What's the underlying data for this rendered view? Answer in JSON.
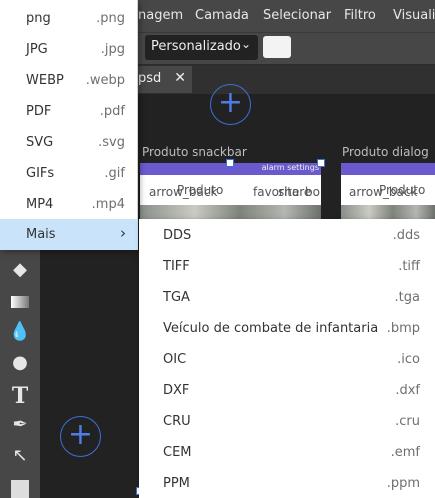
{
  "menubar": {
    "items": [
      "nagem",
      "Camada",
      "Selecionar",
      "Filtro",
      "Visualiz"
    ]
  },
  "options_bar": {
    "colon": ":",
    "preset_value": "Personalizado",
    "swatch_color": "#f3f3f3"
  },
  "document_tab": {
    "label": "psd",
    "close": "✕"
  },
  "artboards": [
    {
      "label": "Produto snackbar",
      "texts": [
        "arrow_back",
        "Produto",
        "favorite",
        "share",
        "bo"
      ],
      "bar_text": "alarm settings"
    },
    {
      "label": "Produto dialog",
      "texts": [
        "arrow_back",
        "Produto"
      ]
    }
  ],
  "export_menu": {
    "items": [
      {
        "label": "png",
        "ext": ".png"
      },
      {
        "label": "JPG",
        "ext": ".jpg"
      },
      {
        "label": "WEBP",
        "ext": ".webp"
      },
      {
        "label": "PDF",
        "ext": ".pdf"
      },
      {
        "label": "SVG",
        "ext": ".svg"
      },
      {
        "label": "GIFs",
        "ext": ".gif"
      },
      {
        "label": "MP4",
        "ext": ".mp4"
      },
      {
        "label": "Mais",
        "ext": "›"
      }
    ]
  },
  "sub_menu": {
    "items": [
      {
        "label": "DDS",
        "ext": ".dds"
      },
      {
        "label": "TIFF",
        "ext": ".tiff"
      },
      {
        "label": "TGA",
        "ext": ".tga"
      },
      {
        "label": "Veículo de combate de infantaria",
        "ext": ".bmp"
      },
      {
        "label": "OIC",
        "ext": ".ico"
      },
      {
        "label": "DXF",
        "ext": ".dxf"
      },
      {
        "label": "CRU",
        "ext": ".cru"
      },
      {
        "label": "CEM",
        "ext": ".emf"
      },
      {
        "label": "PPM",
        "ext": ".ppm"
      }
    ]
  },
  "colors": {
    "menu_highlight": "#c9e4fa",
    "accent_blue": "#3d6fd8",
    "artboard_bar": "#6a5acd"
  }
}
